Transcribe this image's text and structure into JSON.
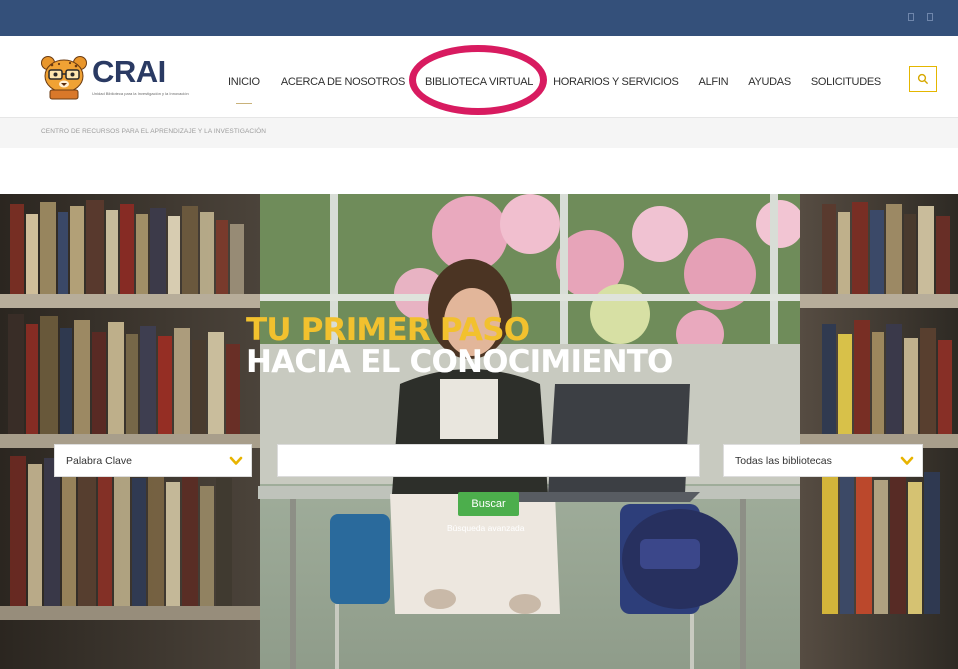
{
  "brand": {
    "name": "CRAI",
    "tagline": "Unidad Biblioteca para la Investigación y la Innovación"
  },
  "nav": {
    "items": [
      {
        "label": "INICIO",
        "active": true
      },
      {
        "label": "ACERCA DE NOSOTROS"
      },
      {
        "label": "BIBLIOTECA VIRTUAL",
        "highlighted": true
      },
      {
        "label": "HORARIOS Y SERVICIOS"
      },
      {
        "label": "ALFIN"
      },
      {
        "label": "AYUDAS"
      },
      {
        "label": "SOLICITUDES"
      }
    ],
    "search_icon": "search-icon"
  },
  "breadcrumb": "CENTRO DE RECURSOS PARA EL APRENDIZAJE Y LA INVESTIGACIÓN",
  "hero": {
    "headline_line1": "TU PRIMER PASO",
    "headline_line2": "HACIA EL CONOCIMIENTO",
    "search": {
      "field_type": "Palabra Clave",
      "query": "",
      "library_scope": "Todas las bibliotecas",
      "submit_label": "Buscar",
      "advanced_link": "Búsqueda avanzada"
    }
  },
  "colors": {
    "top_bar": "#34507a",
    "headline_accent": "#f2c12e",
    "annotation_ring": "#d81b60",
    "submit_green": "#4cae4c",
    "search_border": "#e4b600",
    "chevron": "#e8b400"
  }
}
